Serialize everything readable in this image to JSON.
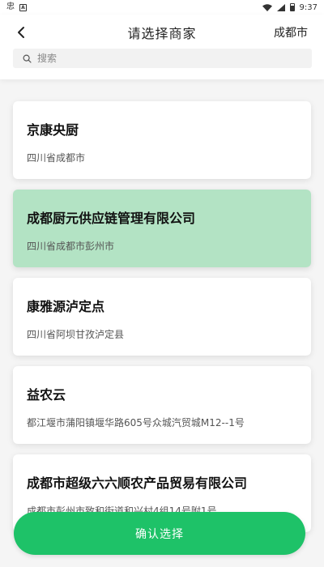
{
  "status_bar": {
    "app_icon_glyph": "忠",
    "a_icon_glyph": "A",
    "time": "9:37",
    "icons": [
      "app-icon",
      "a-icon",
      "wifi-icon",
      "signal-icon",
      "battery-icon"
    ]
  },
  "header": {
    "title": "请选择商家",
    "city": "成都市",
    "back_icon": "chevron-left-icon"
  },
  "search": {
    "placeholder": "搜索",
    "value": "",
    "icon": "search-icon"
  },
  "merchants": [
    {
      "name": "京康央厨",
      "address": "四川省成都市",
      "selected": false
    },
    {
      "name": "成都厨元供应链管理有限公司",
      "address": "四川省成都市彭州市",
      "selected": true
    },
    {
      "name": "康雅源泸定点",
      "address": "四川省阿坝甘孜泸定县",
      "selected": false
    },
    {
      "name": "益农云",
      "address": "都江堰市蒲阳镇堰华路605号众城汽贸城M12--1号",
      "selected": false
    },
    {
      "name": "成都市超级六六顺农产品贸易有限公司",
      "address": "成都市彭州市致和街道和兴村4组14号附1号",
      "selected": false
    }
  ],
  "confirm_button": {
    "label": "确认选择"
  },
  "colors": {
    "accent": "#1ec268",
    "selected_card": "#b3e3c4",
    "background": "#f5f5f5"
  }
}
